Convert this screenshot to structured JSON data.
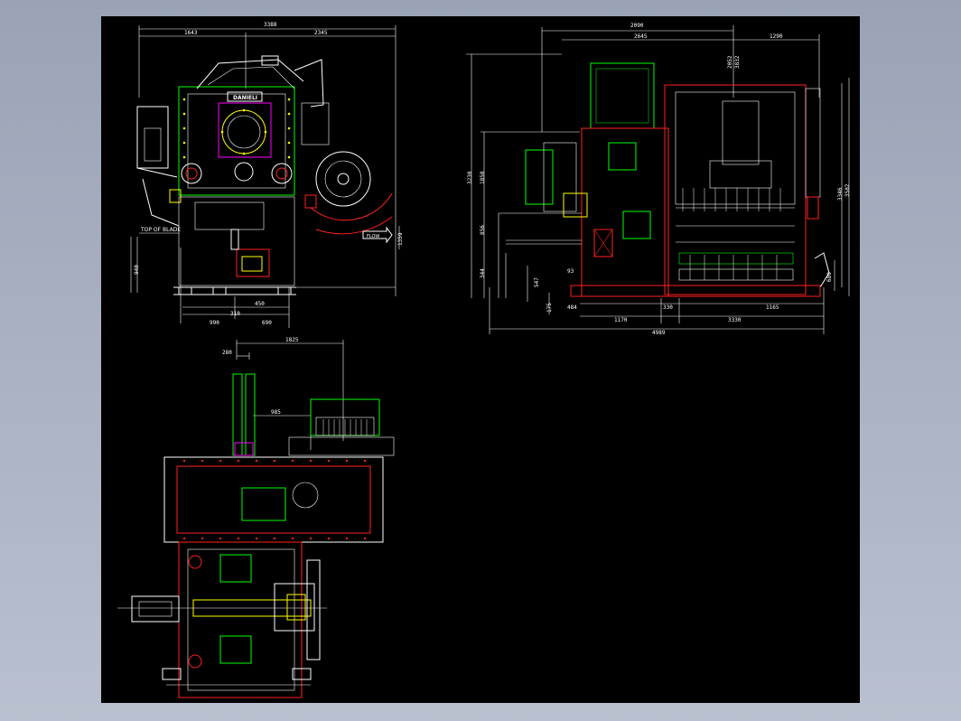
{
  "colors": {
    "background_outer": "#a3abbd",
    "drawing_bg": "#000000",
    "line_white": "#ffffff",
    "line_green": "#00ff00",
    "line_red": "#ff2020",
    "line_yellow": "#ffff00",
    "line_magenta": "#ff00ff",
    "line_cyan": "#00ffff"
  },
  "front_view": {
    "dims": {
      "overall_width": "3388",
      "left_width": "1643",
      "right_width": "2345",
      "height_left": "940",
      "bottom_left": "990",
      "bottom_mid": "310",
      "bottom_right": "690",
      "bottom_small": "450",
      "right_height": "1359"
    },
    "nameplate": "DANIELI",
    "label_blade": "TOP OF BLADE",
    "flow_label": "FLOW"
  },
  "side_view": {
    "dims": {
      "top_overall": "2090",
      "top_left": "2645",
      "top_right": "1290",
      "left_height_outer": "3230",
      "left_height_inner": "1850",
      "left_mid": "856",
      "left_low": "344",
      "left_bottom": "547",
      "left_foot": "175",
      "small_93": "93",
      "small_484": "484",
      "bottom_1170": "1170",
      "bottom_330": "330",
      "bottom_3330": "3330",
      "bottom_1165": "1165",
      "bottom_overall": "4989",
      "right_3346": "3346",
      "right_3582": "3582",
      "right_680": "680",
      "top_vertical_a": "2052",
      "top_vertical_b": "3832"
    }
  },
  "plan_view": {
    "dims": {
      "top_wide": "1825",
      "top_small": "280",
      "mid": "985"
    }
  }
}
